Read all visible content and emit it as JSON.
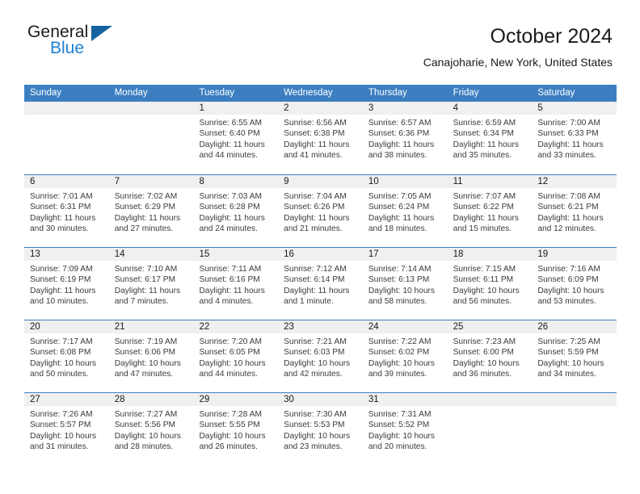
{
  "brand": {
    "name_top": "General",
    "name_bottom": "Blue",
    "accent_color": "#1c7fd4",
    "triangle_color": "#14639f"
  },
  "header": {
    "title": "October 2024",
    "subtitle": "Canajoharie, New York, United States"
  },
  "calendar": {
    "header_bg": "#3c7fc1",
    "daynum_bg": "#f0f0f0",
    "weekdays": [
      "Sunday",
      "Monday",
      "Tuesday",
      "Wednesday",
      "Thursday",
      "Friday",
      "Saturday"
    ],
    "weeks": [
      [
        {
          "day": "",
          "empty": true,
          "sunrise": "",
          "sunset": "",
          "daylight_1": "",
          "daylight_2": ""
        },
        {
          "day": "",
          "empty": true,
          "sunrise": "",
          "sunset": "",
          "daylight_1": "",
          "daylight_2": ""
        },
        {
          "day": "1",
          "empty": false,
          "sunrise": "Sunrise: 6:55 AM",
          "sunset": "Sunset: 6:40 PM",
          "daylight_1": "Daylight: 11 hours",
          "daylight_2": "and 44 minutes."
        },
        {
          "day": "2",
          "empty": false,
          "sunrise": "Sunrise: 6:56 AM",
          "sunset": "Sunset: 6:38 PM",
          "daylight_1": "Daylight: 11 hours",
          "daylight_2": "and 41 minutes."
        },
        {
          "day": "3",
          "empty": false,
          "sunrise": "Sunrise: 6:57 AM",
          "sunset": "Sunset: 6:36 PM",
          "daylight_1": "Daylight: 11 hours",
          "daylight_2": "and 38 minutes."
        },
        {
          "day": "4",
          "empty": false,
          "sunrise": "Sunrise: 6:59 AM",
          "sunset": "Sunset: 6:34 PM",
          "daylight_1": "Daylight: 11 hours",
          "daylight_2": "and 35 minutes."
        },
        {
          "day": "5",
          "empty": false,
          "sunrise": "Sunrise: 7:00 AM",
          "sunset": "Sunset: 6:33 PM",
          "daylight_1": "Daylight: 11 hours",
          "daylight_2": "and 33 minutes."
        }
      ],
      [
        {
          "day": "6",
          "empty": false,
          "sunrise": "Sunrise: 7:01 AM",
          "sunset": "Sunset: 6:31 PM",
          "daylight_1": "Daylight: 11 hours",
          "daylight_2": "and 30 minutes."
        },
        {
          "day": "7",
          "empty": false,
          "sunrise": "Sunrise: 7:02 AM",
          "sunset": "Sunset: 6:29 PM",
          "daylight_1": "Daylight: 11 hours",
          "daylight_2": "and 27 minutes."
        },
        {
          "day": "8",
          "empty": false,
          "sunrise": "Sunrise: 7:03 AM",
          "sunset": "Sunset: 6:28 PM",
          "daylight_1": "Daylight: 11 hours",
          "daylight_2": "and 24 minutes."
        },
        {
          "day": "9",
          "empty": false,
          "sunrise": "Sunrise: 7:04 AM",
          "sunset": "Sunset: 6:26 PM",
          "daylight_1": "Daylight: 11 hours",
          "daylight_2": "and 21 minutes."
        },
        {
          "day": "10",
          "empty": false,
          "sunrise": "Sunrise: 7:05 AM",
          "sunset": "Sunset: 6:24 PM",
          "daylight_1": "Daylight: 11 hours",
          "daylight_2": "and 18 minutes."
        },
        {
          "day": "11",
          "empty": false,
          "sunrise": "Sunrise: 7:07 AM",
          "sunset": "Sunset: 6:22 PM",
          "daylight_1": "Daylight: 11 hours",
          "daylight_2": "and 15 minutes."
        },
        {
          "day": "12",
          "empty": false,
          "sunrise": "Sunrise: 7:08 AM",
          "sunset": "Sunset: 6:21 PM",
          "daylight_1": "Daylight: 11 hours",
          "daylight_2": "and 12 minutes."
        }
      ],
      [
        {
          "day": "13",
          "empty": false,
          "sunrise": "Sunrise: 7:09 AM",
          "sunset": "Sunset: 6:19 PM",
          "daylight_1": "Daylight: 11 hours",
          "daylight_2": "and 10 minutes."
        },
        {
          "day": "14",
          "empty": false,
          "sunrise": "Sunrise: 7:10 AM",
          "sunset": "Sunset: 6:17 PM",
          "daylight_1": "Daylight: 11 hours",
          "daylight_2": "and 7 minutes."
        },
        {
          "day": "15",
          "empty": false,
          "sunrise": "Sunrise: 7:11 AM",
          "sunset": "Sunset: 6:16 PM",
          "daylight_1": "Daylight: 11 hours",
          "daylight_2": "and 4 minutes."
        },
        {
          "day": "16",
          "empty": false,
          "sunrise": "Sunrise: 7:12 AM",
          "sunset": "Sunset: 6:14 PM",
          "daylight_1": "Daylight: 11 hours",
          "daylight_2": "and 1 minute."
        },
        {
          "day": "17",
          "empty": false,
          "sunrise": "Sunrise: 7:14 AM",
          "sunset": "Sunset: 6:13 PM",
          "daylight_1": "Daylight: 10 hours",
          "daylight_2": "and 58 minutes."
        },
        {
          "day": "18",
          "empty": false,
          "sunrise": "Sunrise: 7:15 AM",
          "sunset": "Sunset: 6:11 PM",
          "daylight_1": "Daylight: 10 hours",
          "daylight_2": "and 56 minutes."
        },
        {
          "day": "19",
          "empty": false,
          "sunrise": "Sunrise: 7:16 AM",
          "sunset": "Sunset: 6:09 PM",
          "daylight_1": "Daylight: 10 hours",
          "daylight_2": "and 53 minutes."
        }
      ],
      [
        {
          "day": "20",
          "empty": false,
          "sunrise": "Sunrise: 7:17 AM",
          "sunset": "Sunset: 6:08 PM",
          "daylight_1": "Daylight: 10 hours",
          "daylight_2": "and 50 minutes."
        },
        {
          "day": "21",
          "empty": false,
          "sunrise": "Sunrise: 7:19 AM",
          "sunset": "Sunset: 6:06 PM",
          "daylight_1": "Daylight: 10 hours",
          "daylight_2": "and 47 minutes."
        },
        {
          "day": "22",
          "empty": false,
          "sunrise": "Sunrise: 7:20 AM",
          "sunset": "Sunset: 6:05 PM",
          "daylight_1": "Daylight: 10 hours",
          "daylight_2": "and 44 minutes."
        },
        {
          "day": "23",
          "empty": false,
          "sunrise": "Sunrise: 7:21 AM",
          "sunset": "Sunset: 6:03 PM",
          "daylight_1": "Daylight: 10 hours",
          "daylight_2": "and 42 minutes."
        },
        {
          "day": "24",
          "empty": false,
          "sunrise": "Sunrise: 7:22 AM",
          "sunset": "Sunset: 6:02 PM",
          "daylight_1": "Daylight: 10 hours",
          "daylight_2": "and 39 minutes."
        },
        {
          "day": "25",
          "empty": false,
          "sunrise": "Sunrise: 7:23 AM",
          "sunset": "Sunset: 6:00 PM",
          "daylight_1": "Daylight: 10 hours",
          "daylight_2": "and 36 minutes."
        },
        {
          "day": "26",
          "empty": false,
          "sunrise": "Sunrise: 7:25 AM",
          "sunset": "Sunset: 5:59 PM",
          "daylight_1": "Daylight: 10 hours",
          "daylight_2": "and 34 minutes."
        }
      ],
      [
        {
          "day": "27",
          "empty": false,
          "sunrise": "Sunrise: 7:26 AM",
          "sunset": "Sunset: 5:57 PM",
          "daylight_1": "Daylight: 10 hours",
          "daylight_2": "and 31 minutes."
        },
        {
          "day": "28",
          "empty": false,
          "sunrise": "Sunrise: 7:27 AM",
          "sunset": "Sunset: 5:56 PM",
          "daylight_1": "Daylight: 10 hours",
          "daylight_2": "and 28 minutes."
        },
        {
          "day": "29",
          "empty": false,
          "sunrise": "Sunrise: 7:28 AM",
          "sunset": "Sunset: 5:55 PM",
          "daylight_1": "Daylight: 10 hours",
          "daylight_2": "and 26 minutes."
        },
        {
          "day": "30",
          "empty": false,
          "sunrise": "Sunrise: 7:30 AM",
          "sunset": "Sunset: 5:53 PM",
          "daylight_1": "Daylight: 10 hours",
          "daylight_2": "and 23 minutes."
        },
        {
          "day": "31",
          "empty": false,
          "sunrise": "Sunrise: 7:31 AM",
          "sunset": "Sunset: 5:52 PM",
          "daylight_1": "Daylight: 10 hours",
          "daylight_2": "and 20 minutes."
        },
        {
          "day": "",
          "empty": true,
          "sunrise": "",
          "sunset": "",
          "daylight_1": "",
          "daylight_2": ""
        },
        {
          "day": "",
          "empty": true,
          "sunrise": "",
          "sunset": "",
          "daylight_1": "",
          "daylight_2": ""
        }
      ]
    ]
  }
}
